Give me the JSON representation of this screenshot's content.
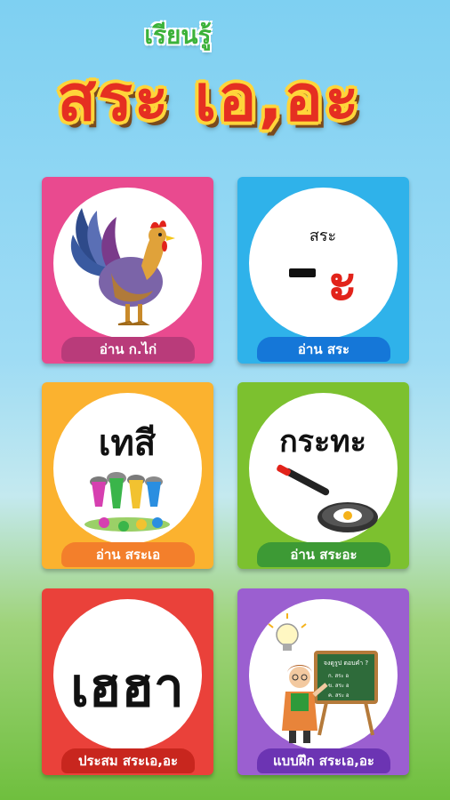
{
  "header": {
    "subtitle": "เรียนรู้",
    "title": "สระ เอ,อะ"
  },
  "menu": [
    {
      "id": "read-consonants",
      "label": "อ่าน ก.ไก่",
      "icon": "rooster-icon",
      "bg": "#e94a8f",
      "bar": "#b93b7a"
    },
    {
      "id": "read-vowels",
      "label": "อ่าน สระ",
      "icon": "vowel-card-icon",
      "bg": "#2fb2ea",
      "bar": "#1577d8",
      "card_text": "สระ",
      "card_vowel": "ะ"
    },
    {
      "id": "read-sara-e",
      "label": "อ่าน สระเอ",
      "icon": "paint-buckets-icon",
      "bg": "#fbb22f",
      "bar": "#f37f2b",
      "card_word": "เทสี"
    },
    {
      "id": "read-sara-a",
      "label": "อ่าน สระอะ",
      "icon": "frying-pan-icon",
      "bg": "#7cc12f",
      "bar": "#3d9a35",
      "card_word": "กระทะ"
    },
    {
      "id": "combine",
      "label": "ประสม สระเอ,อะ",
      "icon": "hecha-word-icon",
      "bg": "#ea413a",
      "bar": "#c8261e",
      "card_word": "เฮฮา"
    },
    {
      "id": "practice",
      "label": "แบบฝึก สระเอ,อะ",
      "icon": "teacher-board-icon",
      "bg": "#9b5fd0",
      "bar": "#6c34b3",
      "board_title": "จงดูรูป ตอบคำ ?",
      "board_lines": [
        "ก. สระ อ",
        "ข. สระ อ",
        "ค. สระ อ"
      ]
    }
  ]
}
